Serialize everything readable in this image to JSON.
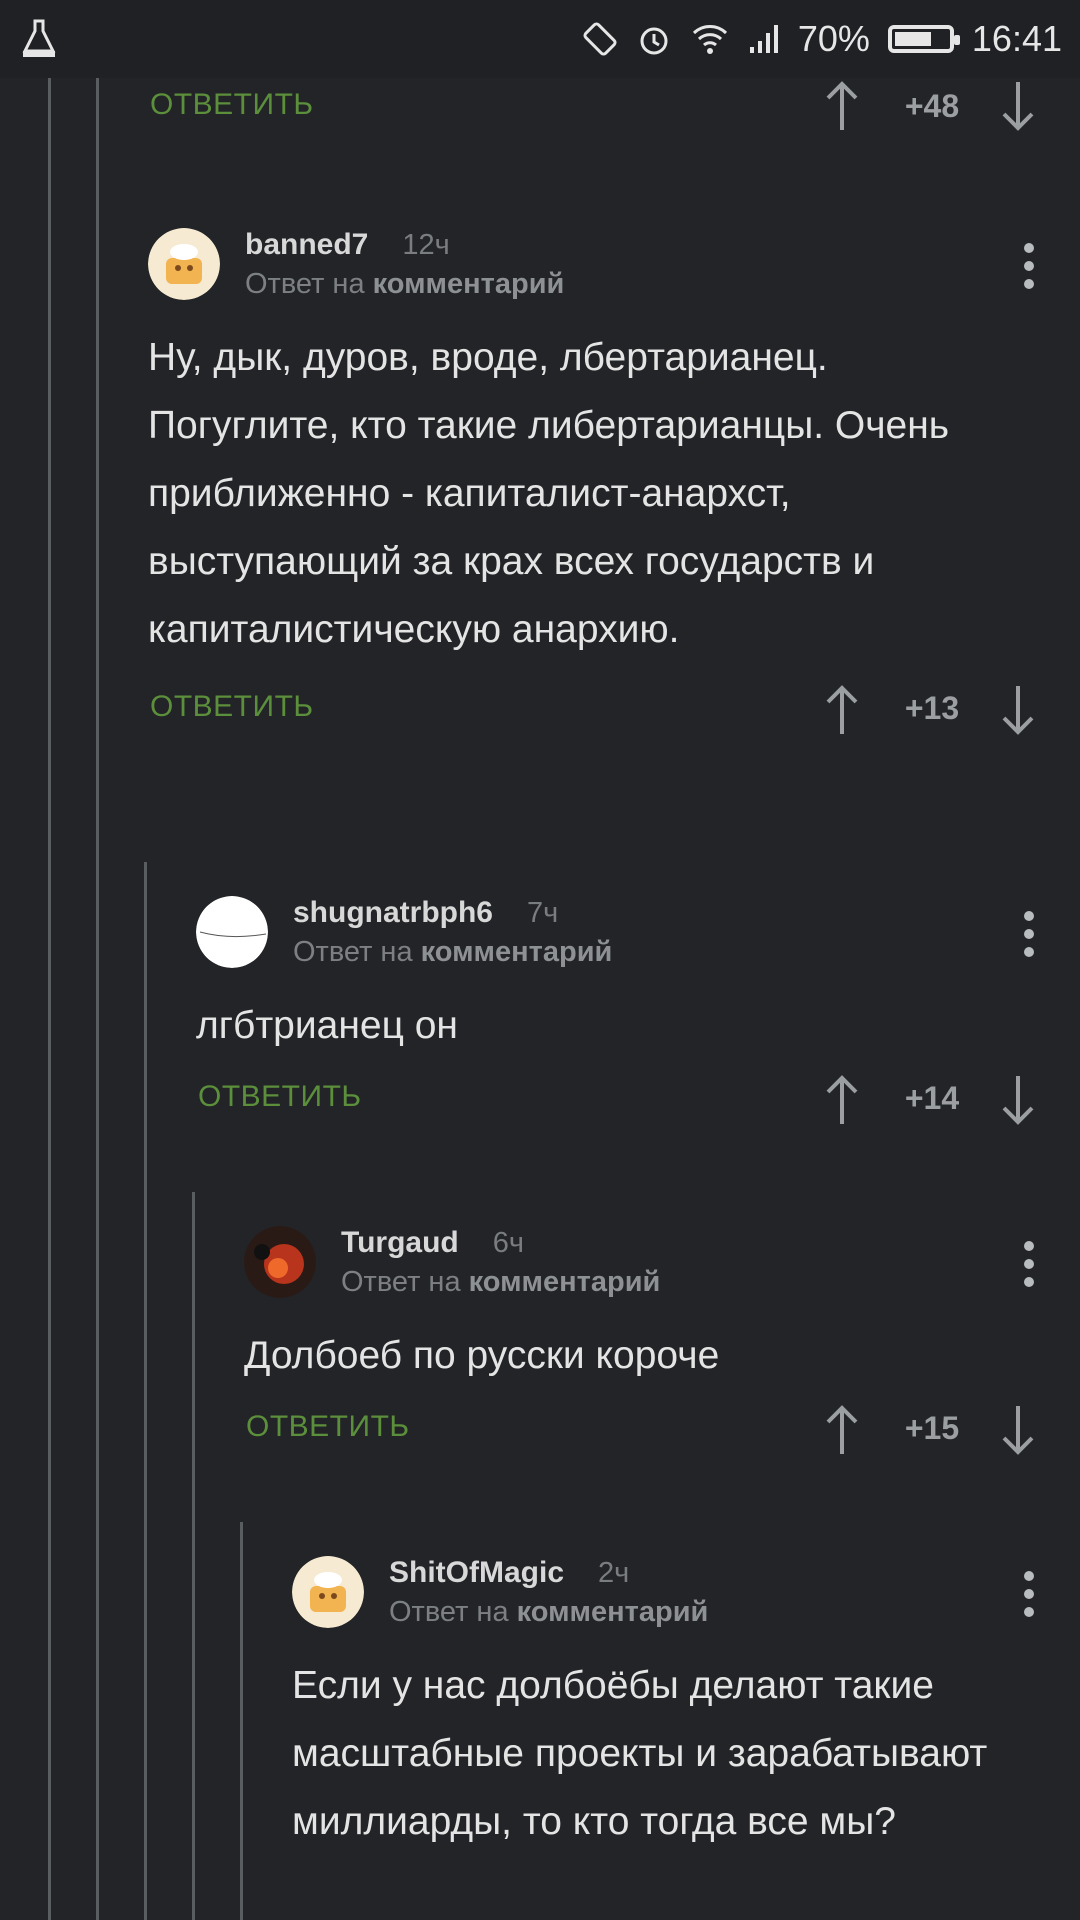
{
  "status": {
    "battery": "70%",
    "time": "16:41",
    "battery_level": 0.7
  },
  "labels": {
    "reply_btn": "ОТВЕТИТЬ",
    "reply_prefix": "Ответ на",
    "reply_target": "комментарий"
  },
  "top_actions": {
    "score": "+48"
  },
  "comments": [
    {
      "user": "banned7",
      "time": "12ч",
      "text": "Ну, дык, дуров, вроде, лбертарианец. Погуглите, кто такие либертарианцы. Очень приближенно - капиталист-анархст, выступающий за крах всех государств и капиталистическую анархию.",
      "score": "+13",
      "avatar": "cake-avatar"
    },
    {
      "user": "shugnatrbph6",
      "time": "7ч",
      "text": "лгбтрианец он",
      "score": "+14",
      "avatar": "white-avatar"
    },
    {
      "user": "Turgaud",
      "time": "6ч",
      "text": "Долбоеб по русски короче",
      "score": "+15",
      "avatar": "fire-avatar"
    },
    {
      "user": "ShitOfMagic",
      "time": "2ч",
      "text": "Если у нас долбоёбы делают такие масштабные проекты и зарабатывают миллиарды, то кто тогда все мы?",
      "score": "",
      "avatar": "cake-avatar"
    }
  ],
  "colors": {
    "background": "#222427",
    "accent_green": "#5c8f3b",
    "muted_text": "#7d8083"
  }
}
